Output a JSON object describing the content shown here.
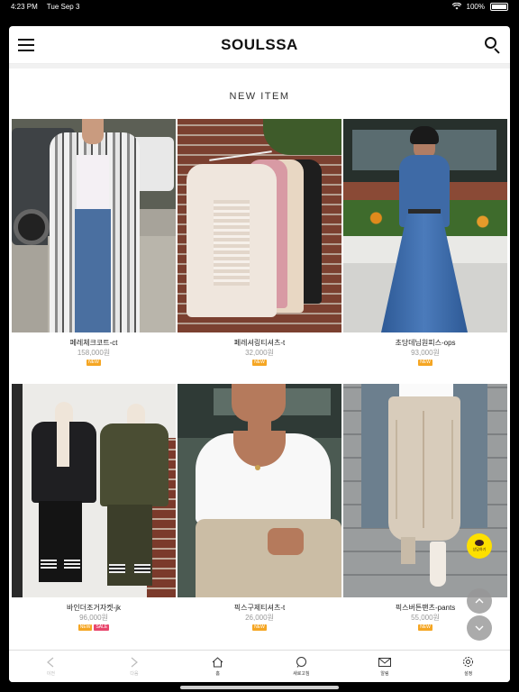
{
  "status_bar": {
    "time": "4:23 PM",
    "date": "Tue Sep 3",
    "battery": "100%"
  },
  "header": {
    "logo": "SOULSSA"
  },
  "section": {
    "title": "NEW ITEM"
  },
  "products": [
    {
      "name": "페레체크코트-ct",
      "price": "158,000원",
      "badges": [
        {
          "text": "NEW",
          "color": "#f5a623"
        }
      ]
    },
    {
      "name": "페레셔링티셔츠-t",
      "price": "32,000원",
      "badges": [
        {
          "text": "NEW",
          "color": "#f5a623"
        }
      ]
    },
    {
      "name": "초당데님원피스-ops",
      "price": "93,000원",
      "badges": [
        {
          "text": "NEW",
          "color": "#f5a623"
        }
      ]
    },
    {
      "name": "바인더조거자켓-jk",
      "price": "96,000원",
      "badges": [
        {
          "text": "NEW",
          "color": "#f5a623"
        },
        {
          "text": "SALE",
          "color": "#e8466c"
        }
      ]
    },
    {
      "name": "픽스구제티셔츠-t",
      "price": "26,000원",
      "badges": [
        {
          "text": "NEW",
          "color": "#f5a623"
        }
      ]
    },
    {
      "name": "픽스버튼팬츠-pants",
      "price": "55,000원",
      "badges": [
        {
          "text": "NEW",
          "color": "#f5a623"
        }
      ]
    }
  ],
  "tabbar": {
    "prev": "이전",
    "next": "다음",
    "home": "홈",
    "refresh": "새로고침",
    "mail": "알림",
    "settings": "설정"
  },
  "kakao_button": {
    "label": "상담하기"
  }
}
